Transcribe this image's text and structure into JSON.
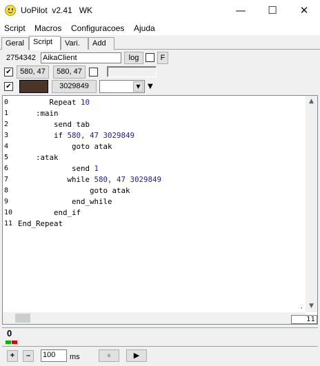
{
  "window": {
    "app_name": "UoPilot",
    "version": "v2.41",
    "tag": "WK",
    "minimize_glyph": "—",
    "maximize_glyph": "☐",
    "close_glyph": "✕"
  },
  "menu": [
    "Script",
    "Macros",
    "Configuracoes",
    "Ajuda"
  ],
  "tabs": [
    {
      "label": "Geral",
      "active": false
    },
    {
      "label": "Script",
      "active": true
    },
    {
      "label": "Vari.",
      "active": false
    },
    {
      "label": "Add",
      "active": false
    }
  ],
  "toolbar": {
    "window_id": "2754342",
    "window_name": "AikaClient",
    "log_label": "log",
    "f_label": "F",
    "coords1": "580, 47",
    "coords2": "580, 47",
    "color_value": "3029849",
    "color_swatch": "#4a3528"
  },
  "editor": {
    "lines": [
      {
        "n": "0",
        "indent": 7,
        "parts": [
          [
            "Repeat ",
            "t"
          ],
          [
            "10",
            "n"
          ]
        ]
      },
      {
        "n": "1",
        "indent": 4,
        "parts": [
          [
            ":main",
            "t"
          ]
        ]
      },
      {
        "n": "2",
        "indent": 8,
        "parts": [
          [
            "send tab",
            "t"
          ]
        ]
      },
      {
        "n": "3",
        "indent": 8,
        "parts": [
          [
            "if ",
            "t"
          ],
          [
            "580, 47 3029849",
            "n"
          ]
        ]
      },
      {
        "n": "4",
        "indent": 12,
        "parts": [
          [
            "goto atak",
            "t"
          ]
        ]
      },
      {
        "n": "5",
        "indent": 4,
        "parts": [
          [
            ":atak",
            "t"
          ]
        ]
      },
      {
        "n": "6",
        "indent": 12,
        "parts": [
          [
            "send ",
            "t"
          ],
          [
            "1",
            "n"
          ]
        ]
      },
      {
        "n": "7",
        "indent": 11,
        "parts": [
          [
            "while ",
            "t"
          ],
          [
            "580, 47 3029849",
            "n"
          ]
        ]
      },
      {
        "n": "8",
        "indent": 16,
        "parts": [
          [
            "goto atak",
            "t"
          ]
        ]
      },
      {
        "n": "9",
        "indent": 12,
        "parts": [
          [
            "end_while",
            "t"
          ]
        ]
      },
      {
        "n": "10",
        "indent": 8,
        "parts": [
          [
            "end_if",
            "t"
          ]
        ]
      },
      {
        "n": "11",
        "indent": 0,
        "parts": [
          [
            "End_Repeat",
            "t"
          ]
        ]
      }
    ],
    "cursor_line": "11",
    "cursor_tick": "`"
  },
  "status": {
    "counter": "0",
    "led_green": "#00b400",
    "led_red": "#e00000",
    "plus_label": "+",
    "minus_label": "–",
    "delay_value": "100",
    "unit": "ms",
    "pause_glyph": "⏸",
    "play_glyph": "▶"
  }
}
